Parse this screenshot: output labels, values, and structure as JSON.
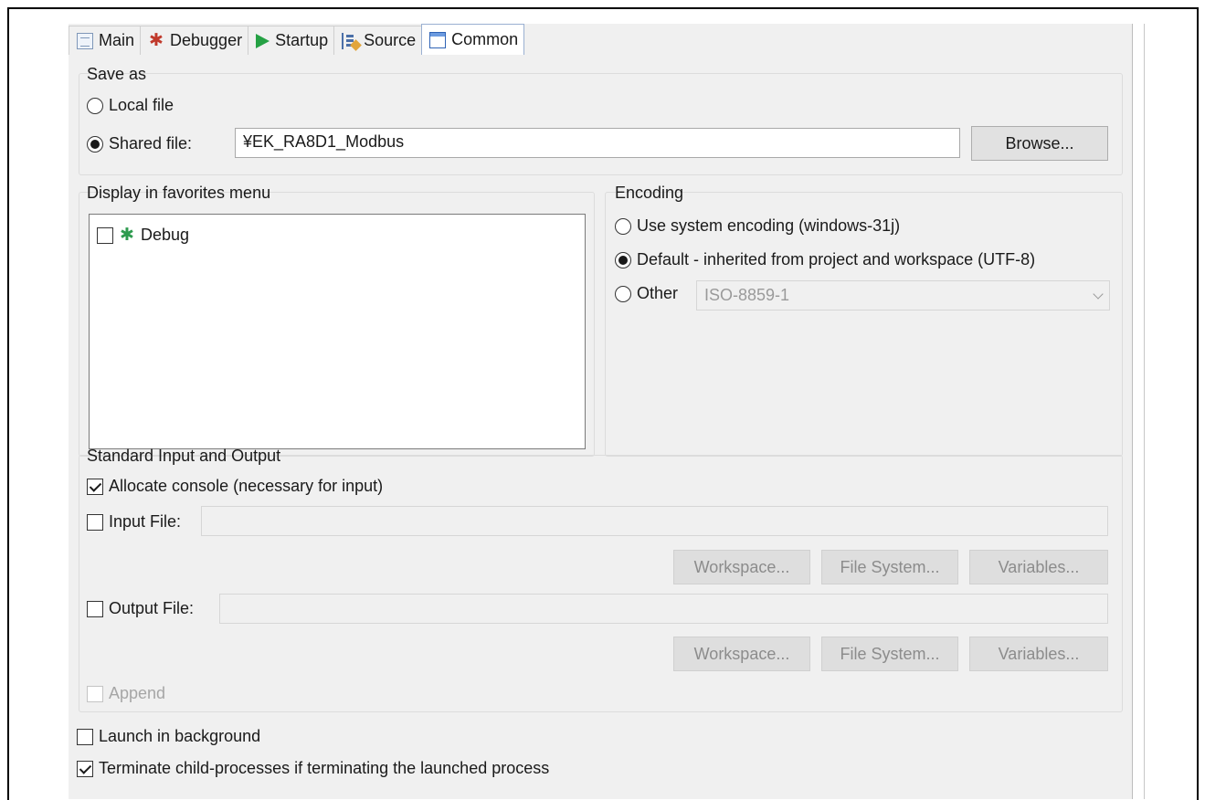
{
  "tabs": [
    {
      "label": "Main",
      "icon": "document-icon"
    },
    {
      "label": "Debugger",
      "icon": "debug-bug-icon"
    },
    {
      "label": "Startup",
      "icon": "play-icon"
    },
    {
      "label": "Source",
      "icon": "source-lookup-icon"
    },
    {
      "label": "Common",
      "icon": "window-icon",
      "active": true
    }
  ],
  "save_as": {
    "title": "Save as",
    "local_file": "Local file",
    "shared_file": "Shared file:",
    "shared_path": "¥EK_RA8D1_Modbus",
    "selected": "shared_file",
    "browse": "Browse..."
  },
  "favorites": {
    "title": "Display in favorites menu",
    "items": [
      {
        "label": "Debug",
        "checked": false,
        "icon": "debug-icon"
      }
    ]
  },
  "encoding": {
    "title": "Encoding",
    "system": "Use system encoding (windows-31j)",
    "default": "Default - inherited from project and workspace (UTF-8)",
    "other": "Other",
    "other_value": "ISO-8859-1",
    "selected": "default"
  },
  "stdio": {
    "title": "Standard Input and Output",
    "allocate_console": "Allocate console (necessary for input)",
    "allocate_checked": true,
    "input_file": "Input File:",
    "input_value": "",
    "output_file": "Output File:",
    "output_value": "",
    "workspace": "Workspace...",
    "file_system": "File System...",
    "variables": "Variables...",
    "append": "Append"
  },
  "launch_background": "Launch in background",
  "launch_background_checked": false,
  "terminate_children": "Terminate child-processes if terminating the launched process",
  "terminate_children_checked": true
}
